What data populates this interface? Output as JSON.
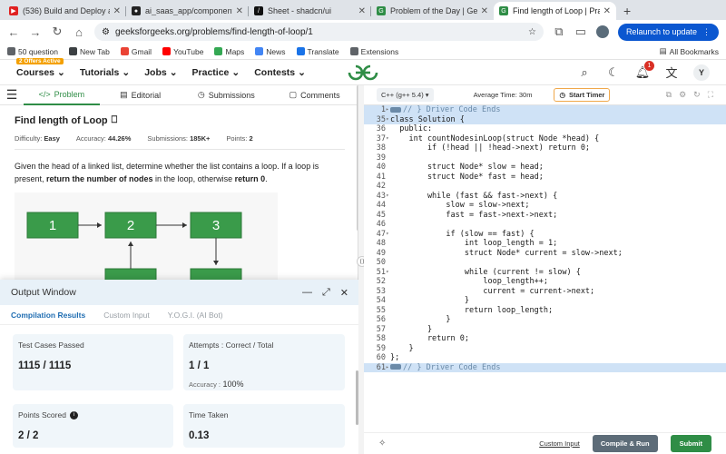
{
  "browser": {
    "tabs": [
      {
        "title": "(536) Build and Deploy a Full",
        "fav_color": "#e02020",
        "fav_glyph": "▶"
      },
      {
        "title": "ai_saas_app/components/sh",
        "fav_color": "#222222",
        "fav_glyph": "●"
      },
      {
        "title": "Sheet - shadcn/ui",
        "fav_color": "#111111",
        "fav_glyph": "/"
      },
      {
        "title": "Problem of the Day | Geeksfo",
        "fav_color": "#2f8d46",
        "fav_glyph": "G"
      },
      {
        "title": "Find length of Loop | Practice",
        "fav_color": "#2f8d46",
        "fav_glyph": "G"
      }
    ],
    "url": "geeksforgeeks.org/problems/find-length-of-loop/1",
    "relaunch_label": "Relaunch to update",
    "bookmarks": [
      {
        "label": "50 question",
        "color": "#5f6368"
      },
      {
        "label": "New Tab",
        "color": "#3c4043"
      },
      {
        "label": "Gmail",
        "color": "#ea4335"
      },
      {
        "label": "YouTube",
        "color": "#ff0000"
      },
      {
        "label": "Maps",
        "color": "#34a853"
      },
      {
        "label": "News",
        "color": "#4285f4"
      },
      {
        "label": "Translate",
        "color": "#1a73e8"
      },
      {
        "label": "Extensions",
        "color": "#5f6368"
      }
    ],
    "all_bookmarks": "All Bookmarks"
  },
  "site": {
    "offers_badge": "2 Offers Active",
    "nav": [
      "Courses",
      "Tutorials",
      "Jobs",
      "Practice",
      "Contests"
    ],
    "notif_count": "1",
    "avatar_letter": "Y",
    "brand_color": "#2f8d46"
  },
  "problem": {
    "tabs": [
      "Problem",
      "Editorial",
      "Submissions",
      "Comments"
    ],
    "title": "Find length of Loop",
    "difficulty_label": "Difficulty:",
    "difficulty": "Easy",
    "accuracy_label": "Accuracy:",
    "accuracy": "44.26%",
    "submissions_label": "Submissions:",
    "submissions": "185K+",
    "points_label": "Points:",
    "points": "2",
    "desc_1": "Given the head of a linked list, determine whether the list contains a loop. If a loop is present, ",
    "desc_b1": "return the number of nodes",
    "desc_2": " in the loop, otherwise ",
    "desc_b2": "return 0",
    "desc_3": ".",
    "diagram_nodes": [
      "1",
      "2",
      "3"
    ]
  },
  "output": {
    "title": "Output Window",
    "tabs": [
      "Compilation Results",
      "Custom Input",
      "Y.O.G.I. (AI Bot)"
    ],
    "test_cases_label": "Test Cases Passed",
    "test_cases_value": "1115 / 1115",
    "attempts_label": "Attempts : Correct / Total",
    "attempts_value": "1 / 1",
    "accuracy_label": "Accuracy :",
    "accuracy_value": "100%",
    "points_label": "Points Scored",
    "points_value": "2 / 2",
    "time_label": "Time Taken",
    "time_value": "0.13"
  },
  "editor": {
    "language": "C++ (g++ 5.4)",
    "avg_time": "Average Time: 30m",
    "start_timer": "Start Timer",
    "custom_input": "Custom Input",
    "compile_run": "Compile & Run",
    "submit": "Submit",
    "lines": [
      {
        "n": "1",
        "fold": "▸",
        "text": "// } Driver Code Ends",
        "hl": true,
        "marker": true
      },
      {
        "n": "35",
        "fold": "▾",
        "text": "class Solution {",
        "hl": true
      },
      {
        "n": "36",
        "fold": "",
        "text": "  public:"
      },
      {
        "n": "37",
        "fold": "▾",
        "text": "    int countNodesinLoop(struct Node *head) {"
      },
      {
        "n": "38",
        "fold": "",
        "text": "        if (!head || !head->next) return 0;"
      },
      {
        "n": "39",
        "fold": "",
        "text": ""
      },
      {
        "n": "40",
        "fold": "",
        "text": "        struct Node* slow = head;"
      },
      {
        "n": "41",
        "fold": "",
        "text": "        struct Node* fast = head;"
      },
      {
        "n": "42",
        "fold": "",
        "text": ""
      },
      {
        "n": "43",
        "fold": "▾",
        "text": "        while (fast && fast->next) {"
      },
      {
        "n": "44",
        "fold": "",
        "text": "            slow = slow->next;"
      },
      {
        "n": "45",
        "fold": "",
        "text": "            fast = fast->next->next;"
      },
      {
        "n": "46",
        "fold": "",
        "text": ""
      },
      {
        "n": "47",
        "fold": "▾",
        "text": "            if (slow == fast) {"
      },
      {
        "n": "48",
        "fold": "",
        "text": "                int loop_length = 1;"
      },
      {
        "n": "49",
        "fold": "",
        "text": "                struct Node* current = slow->next;"
      },
      {
        "n": "50",
        "fold": "",
        "text": ""
      },
      {
        "n": "51",
        "fold": "▾",
        "text": "                while (current != slow) {"
      },
      {
        "n": "52",
        "fold": "",
        "text": "                    loop_length++;"
      },
      {
        "n": "53",
        "fold": "",
        "text": "                    current = current->next;"
      },
      {
        "n": "54",
        "fold": "",
        "text": "                }"
      },
      {
        "n": "55",
        "fold": "",
        "text": "                return loop_length;"
      },
      {
        "n": "56",
        "fold": "",
        "text": "            }"
      },
      {
        "n": "57",
        "fold": "",
        "text": "        }"
      },
      {
        "n": "58",
        "fold": "",
        "text": "        return 0;"
      },
      {
        "n": "59",
        "fold": "",
        "text": "    }"
      },
      {
        "n": "60",
        "fold": "",
        "text": "};"
      },
      {
        "n": "61",
        "fold": "▸",
        "text": "// } Driver Code Ends",
        "hl": true,
        "marker": true
      }
    ]
  }
}
